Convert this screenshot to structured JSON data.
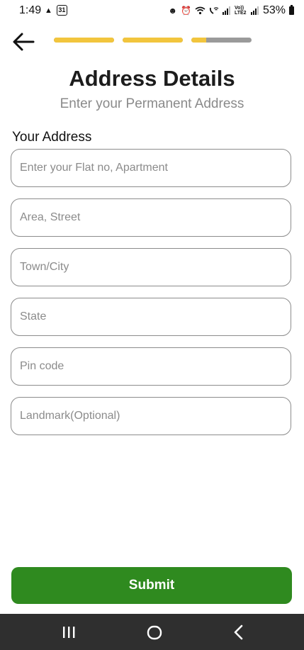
{
  "status_bar": {
    "time": "1:49",
    "calendar_day": "31",
    "battery_percent": "53%",
    "network_label": "Vo)) LTE2"
  },
  "progress": {
    "steps": [
      {
        "fill": 1.0
      },
      {
        "fill": 1.0
      },
      {
        "fill": 0.25
      }
    ],
    "active_color": "#f2c53d",
    "inactive_color": "#9a9a9a"
  },
  "header": {
    "title": "Address Details",
    "subtitle": "Enter your Permanent Address"
  },
  "form": {
    "section_label": "Your Address",
    "fields": [
      {
        "placeholder": "Enter your Flat no, Apartment",
        "value": ""
      },
      {
        "placeholder": "Area, Street",
        "value": ""
      },
      {
        "placeholder": "Town/City",
        "value": ""
      },
      {
        "placeholder": "State",
        "value": ""
      },
      {
        "placeholder": "Pin code",
        "value": ""
      },
      {
        "placeholder": "Landmark(Optional)",
        "value": ""
      }
    ],
    "submit_label": "Submit",
    "submit_color": "#2f8a1f"
  },
  "icons": {
    "back": "arrow-left-icon",
    "nav_recent": "recent-apps-icon",
    "nav_home": "home-icon",
    "nav_back": "nav-back-icon"
  }
}
